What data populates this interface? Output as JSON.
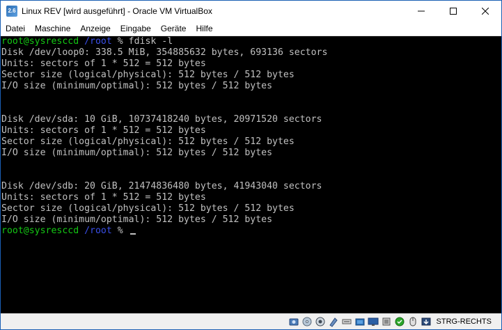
{
  "window": {
    "title": "Linux REV [wird ausgeführt] - Oracle VM VirtualBox",
    "app_icon_text": "2.6"
  },
  "menu": [
    {
      "label": "Datei"
    },
    {
      "label": "Maschine"
    },
    {
      "label": "Anzeige"
    },
    {
      "label": "Eingabe"
    },
    {
      "label": "Geräte"
    },
    {
      "label": "Hilfe"
    }
  ],
  "prompt": {
    "user_host": "root@sysresccd",
    "path": "/root",
    "symbol": "%"
  },
  "console": {
    "command": "fdisk -l",
    "output": [
      "Disk /dev/loop0: 338.5 MiB, 354885632 bytes, 693136 sectors",
      "Units: sectors of 1 * 512 = 512 bytes",
      "Sector size (logical/physical): 512 bytes / 512 bytes",
      "I/O size (minimum/optimal): 512 bytes / 512 bytes",
      "",
      "",
      "Disk /dev/sda: 10 GiB, 10737418240 bytes, 20971520 sectors",
      "Units: sectors of 1 * 512 = 512 bytes",
      "Sector size (logical/physical): 512 bytes / 512 bytes",
      "I/O size (minimum/optimal): 512 bytes / 512 bytes",
      "",
      "",
      "Disk /dev/sdb: 20 GiB, 21474836480 bytes, 41943040 sectors",
      "Units: sectors of 1 * 512 = 512 bytes",
      "Sector size (logical/physical): 512 bytes / 512 bytes",
      "I/O size (minimum/optimal): 512 bytes / 512 bytes"
    ]
  },
  "statusbar": {
    "host_key": "STRG-RECHTS",
    "icons": [
      "hard-disk-icon",
      "optical-drive-icon",
      "audio-icon",
      "network-icon",
      "usb-icon",
      "shared-folders-icon",
      "display-icon",
      "video-capture-icon",
      "cpu-icon",
      "mouse-integration-icon",
      "keyboard-capture-icon"
    ]
  },
  "colors": {
    "prompt_user": "#14c814",
    "prompt_path": "#3a4fe8",
    "console_text": "#c0c0c0",
    "console_bg": "#000000",
    "window_border": "#1a5fb4"
  }
}
